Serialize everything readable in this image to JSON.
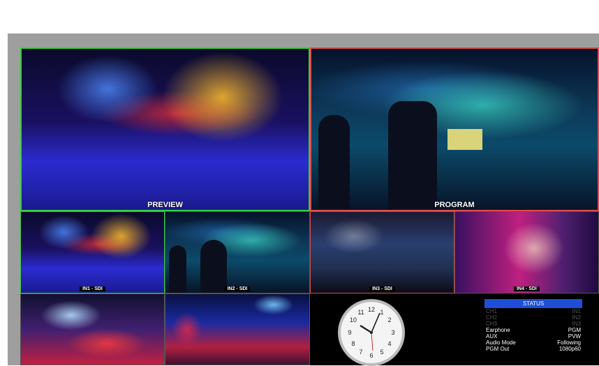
{
  "labels": {
    "preview": "PREVIEW",
    "program": "PROGRAM",
    "in1": "IN1 - SDI",
    "in2": "IN2 - SDI",
    "in3": "IN3 - SDI",
    "in4": "IN4 - SDI"
  },
  "status": {
    "title": "STATUS",
    "rows": [
      {
        "k": "CH1",
        "v": "IN1",
        "dim": true
      },
      {
        "k": "CH2",
        "v": "IN2",
        "dim": true
      },
      {
        "k": "CH3",
        "v": "IN3",
        "dim": true
      },
      {
        "k": "Earphone",
        "v": "PGM",
        "dim": false
      },
      {
        "k": "AUX",
        "v": "PVW",
        "dim": false
      },
      {
        "k": "Audio Mode",
        "v": "Following",
        "dim": false
      },
      {
        "k": "PGM Out",
        "v": "1080p60",
        "dim": false
      }
    ]
  },
  "colors": {
    "preview_tally": "#31d13a",
    "program_tally": "#e14a4a",
    "status_header": "#1f4fd6"
  }
}
